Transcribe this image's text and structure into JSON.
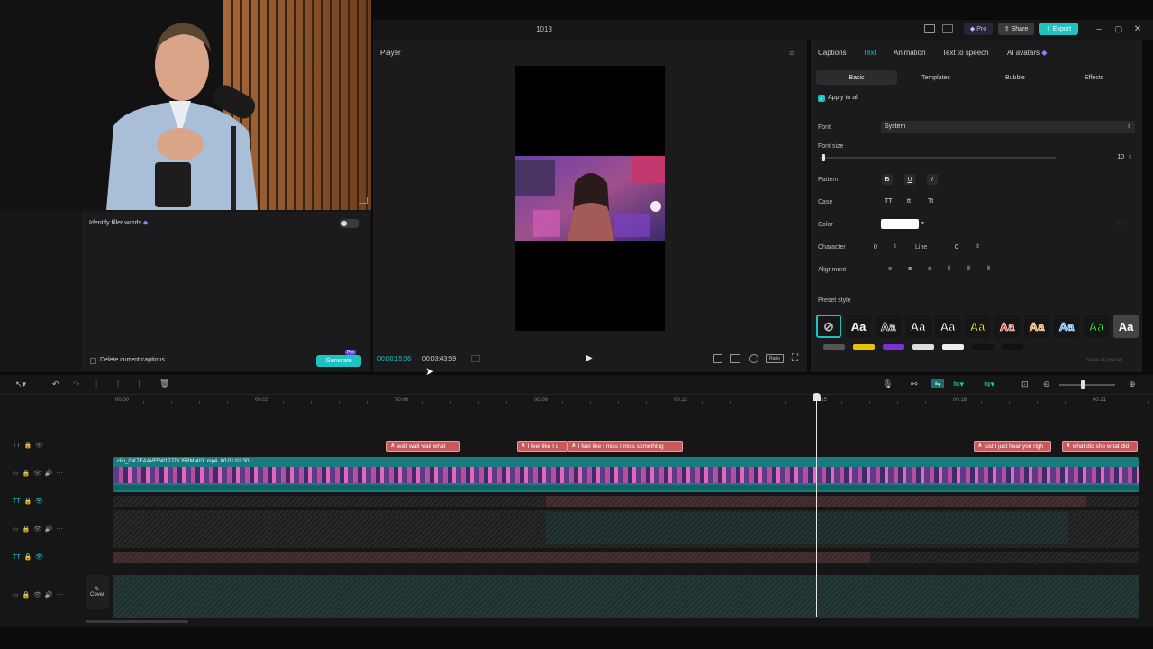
{
  "app": {
    "title": "1013"
  },
  "topbar": {
    "pro_label": "Pro",
    "share_label": "Share",
    "export_label": "Export"
  },
  "left_panel": {
    "filler_label": "Identify filler words",
    "delete_label": "Delete current captions",
    "generate_label": "Generate",
    "generate_badge": "Pro"
  },
  "player": {
    "title": "Player",
    "current_time": "00:00:15:06",
    "total_time": "00:03:43:59",
    "ratio_label": "Ratio"
  },
  "right_panel": {
    "tabs": [
      "Captions",
      "Text",
      "Animation",
      "Text to speech",
      "AI avatars"
    ],
    "active_tab": "Text",
    "subtabs": [
      "Basic",
      "Templates",
      "Bubble",
      "Effects"
    ],
    "active_subtab": "Basic",
    "apply_all": "Apply to all",
    "font_label": "Font",
    "font_value": "System",
    "font_size_label": "Font size",
    "font_size_value": "10",
    "font_size_fraction": 0.02,
    "pattern_label": "Pattern",
    "pattern_buttons": [
      "B",
      "U",
      "I"
    ],
    "case_label": "Case",
    "case_buttons": [
      "TT",
      "tt",
      "Tt"
    ],
    "color_label": "Color",
    "color_value": "#ffffff",
    "character_label": "Character",
    "character_value": "0",
    "line_label": "Line",
    "line_value": "0",
    "alignment_label": "Alignment",
    "preset_label": "Preset style",
    "preset_sample": "Aa",
    "save_preset": "Save as preset",
    "presets": [
      {
        "color": "#ffffff",
        "outline": "none"
      },
      {
        "color": "#111111",
        "outline": "#ffffff"
      },
      {
        "color": "#ffffff",
        "outline": "#111111"
      },
      {
        "color": "#ffffff",
        "outline": "#000000"
      },
      {
        "color": "#f5e12a",
        "outline": "#000000"
      },
      {
        "color": "#e8393f",
        "outline": "#ffffff"
      },
      {
        "color": "#f29b28",
        "outline": "#ffffff"
      },
      {
        "color": "#3aa6f5",
        "outline": "#ffffff"
      },
      {
        "color": "#47d14a",
        "outline": "#000000"
      },
      {
        "color": "#ffffff",
        "outline": "none"
      }
    ]
  },
  "timeline": {
    "ticks": [
      "00:00",
      "00:03",
      "00:06",
      "00:09",
      "00:12",
      "00:15",
      "00:18",
      "00:21"
    ],
    "playhead_label": "00:15",
    "clip_label": "clip_0!K7EAAVF5W17J7KJ5RM.4!!X.mp4",
    "clip_duration": "00:01:02:30",
    "cover_label": "Cover",
    "captions": [
      {
        "text": "wait wait wait what"
      },
      {
        "text": "I feel like I c"
      },
      {
        "text": "I feel like I miss I miss something"
      },
      {
        "text": "just I just hear you righ"
      },
      {
        "text": "what did she what did"
      }
    ],
    "caption_badge": "A"
  },
  "colors": {
    "accent": "#1ec2c2",
    "caption": "#c9585a",
    "bg": "#161617"
  }
}
